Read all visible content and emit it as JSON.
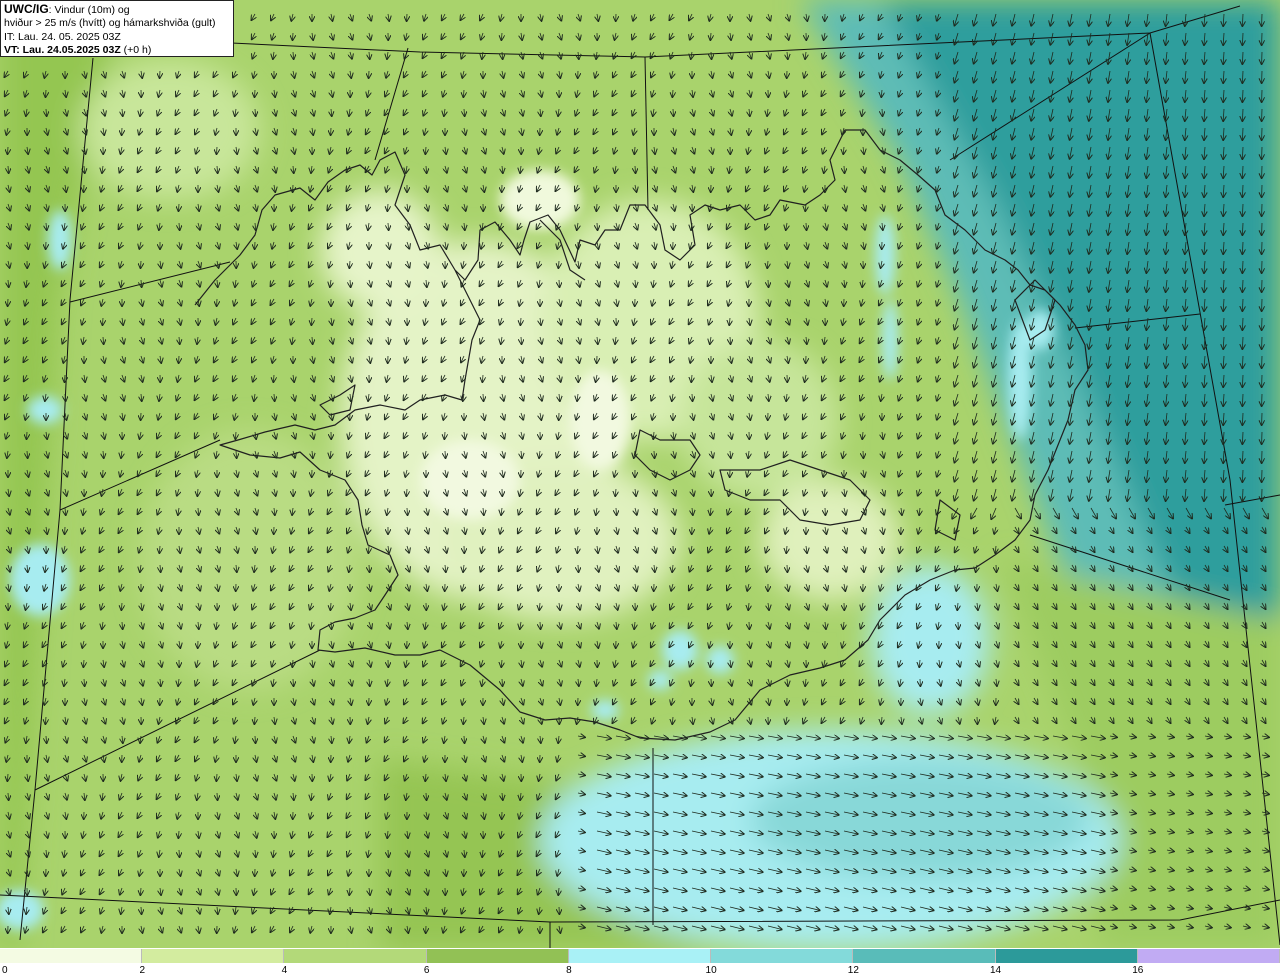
{
  "header": {
    "model": "UWC/IG",
    "desc_part1": ": Vindur (10m) og",
    "desc_part2": "hviður > 25 m/s (hvítt) og hámarkshviða (gult)",
    "it_line": "IT: Lau. 24. 05. 2025 03Z",
    "vt_line": "VT: Lau. 24.05.2025 03Z",
    "vt_offset": "(+0 h)"
  },
  "colors": {
    "sea_dark": "#2b9c9c",
    "sea_mid": "#58b8b3",
    "sea_light": "#86d7d6",
    "sea_cyan": "#a6ecf0",
    "land_base": "#a9d36c",
    "land_dark": "#8ec047",
    "land_light": "#c8e69a",
    "land_pale": "#eaf6cf",
    "coast": "#202020",
    "arrow": "#1e2a1e"
  },
  "legend": {
    "ticks": [
      "0",
      "2",
      "4",
      "6",
      "8",
      "10",
      "12",
      "14",
      "16"
    ],
    "colors": [
      "#f4fbe3",
      "#d3ec9f",
      "#b3d979",
      "#92c155",
      "#a9f1f6",
      "#83dada",
      "#59bcb9",
      "#2c9a9a",
      "#c1abf3"
    ]
  }
}
